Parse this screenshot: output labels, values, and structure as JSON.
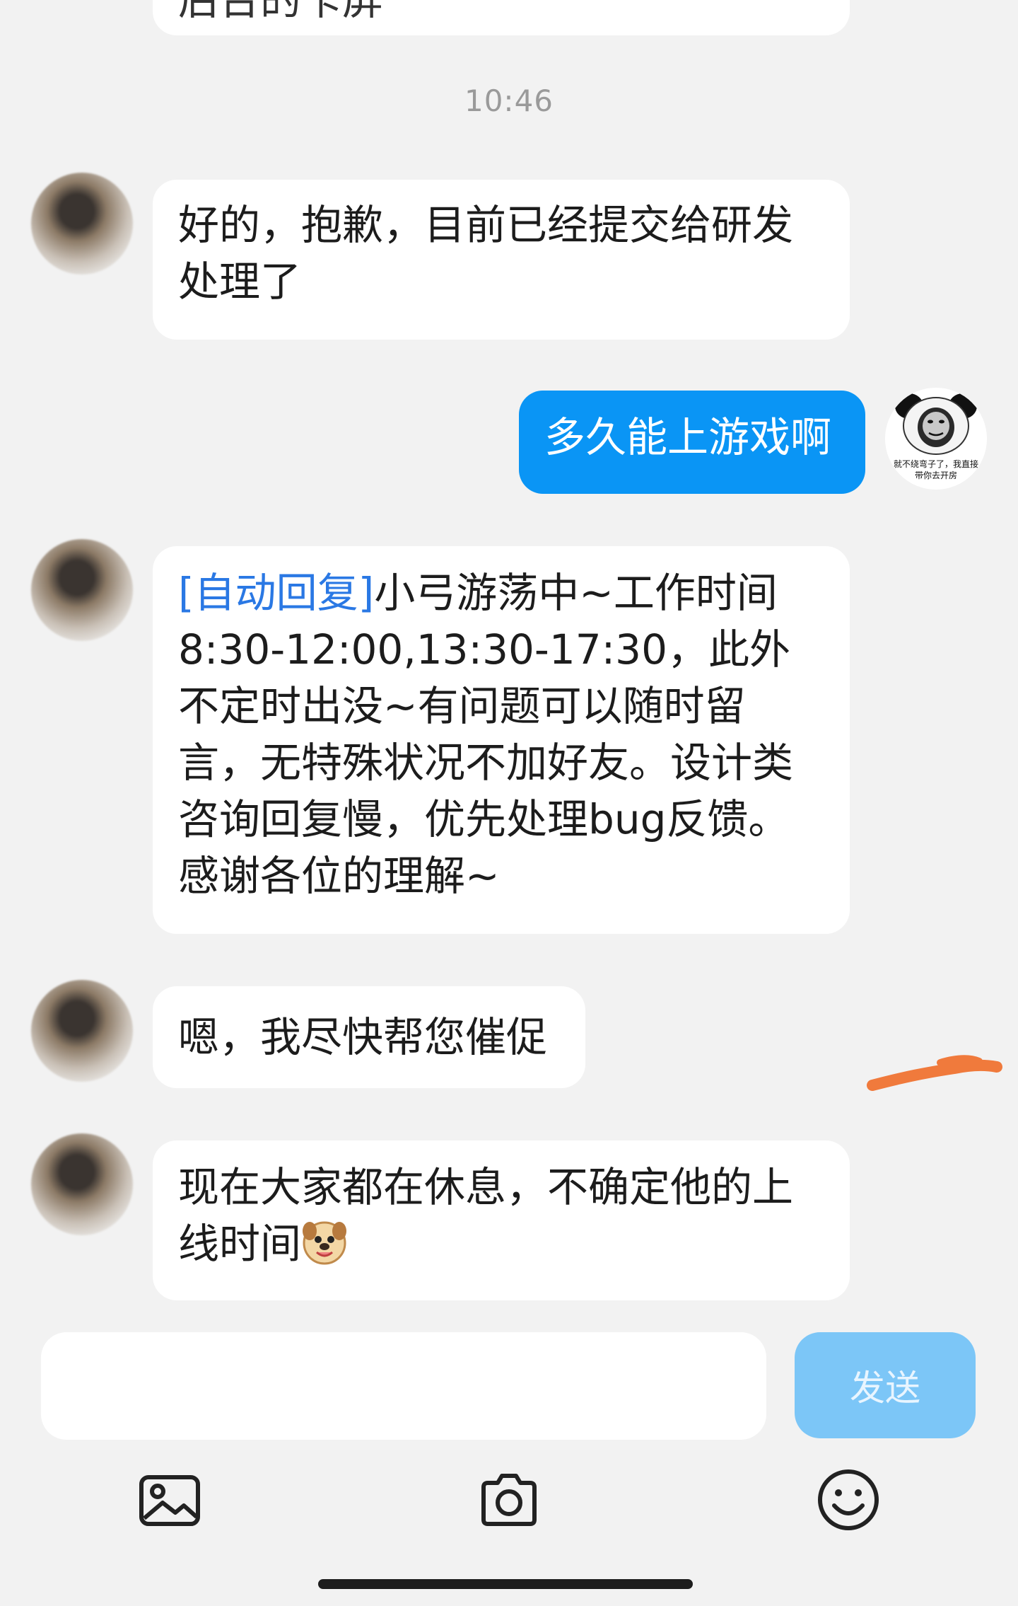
{
  "chat": {
    "partial_bubble": "后台的卡屏",
    "timestamp": "10:46",
    "messages": [
      {
        "text": "好的，抱歉，目前已经提交给研发处理了"
      },
      {
        "text": "多久能上游戏啊",
        "avatar_caption": "就不绕弯子了，我直接带你去开房"
      },
      {
        "tag": "[自动回复]",
        "text": "小弓游荡中~工作时间8:30-12:00,13:30-17:30，此外不定时出没~有问题可以随时留言，无特殊状况不加好友。设计类咨询回复慢，优先处理bug反馈。感谢各位的理解~"
      },
      {
        "text": "嗯，我尽快帮您催促"
      },
      {
        "text": "现在大家都在休息，不确定他的上线时间"
      }
    ]
  },
  "input": {
    "value": "",
    "send_label": "发送"
  },
  "toolbar": {
    "items": [
      "image-icon",
      "camera-icon",
      "emoji-icon"
    ]
  },
  "colors": {
    "self_bubble": "#0a95f5",
    "tag_text": "#2a78e4",
    "send_button": "#7cc6f7",
    "stroke_mark": "#f07a3c"
  }
}
